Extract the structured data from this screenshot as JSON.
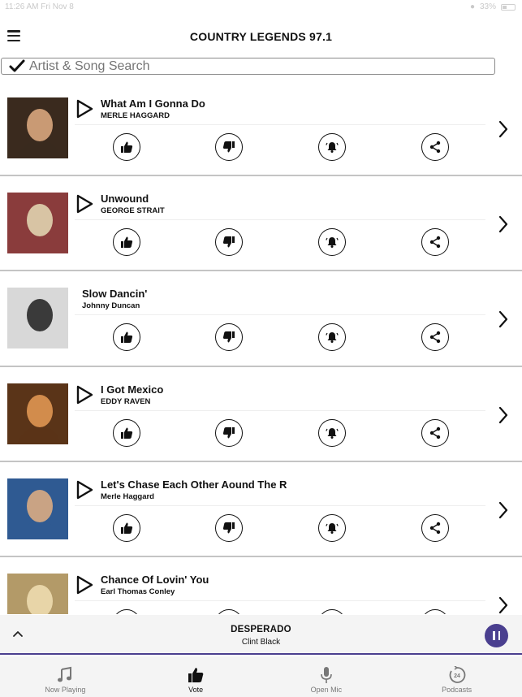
{
  "status_bar": {
    "time": "11:26 AM  Fri Nov 8",
    "battery": "33%"
  },
  "header": {
    "title": "COUNTRY LEGENDS 97.1"
  },
  "search": {
    "placeholder": "Artist & Song Search"
  },
  "songs": [
    {
      "title": "What Am I Gonna Do",
      "artist": "MERLE HAGGARD",
      "has_play": true,
      "art_colors": [
        "#3a2a1e",
        "#c99a74"
      ]
    },
    {
      "title": "Unwound",
      "artist": "GEORGE STRAIT",
      "has_play": true,
      "art_colors": [
        "#8a3c3c",
        "#d8c4a4"
      ]
    },
    {
      "title": "Slow Dancin'",
      "artist": "Johnny Duncan",
      "has_play": false,
      "art_colors": [
        "#d8d8d8",
        "#3a3a3a"
      ]
    },
    {
      "title": "I Got Mexico",
      "artist": "EDDY RAVEN",
      "has_play": true,
      "art_colors": [
        "#5a3418",
        "#d28c4c"
      ]
    },
    {
      "title": "Let's Chase Each Other Aound The R",
      "artist": "Merle Haggard",
      "has_play": true,
      "art_colors": [
        "#2f5a92",
        "#c9a384"
      ]
    },
    {
      "title": "Chance Of Lovin' You",
      "artist": "Earl Thomas Conley",
      "has_play": true,
      "art_colors": [
        "#b39a68",
        "#e8d5a8"
      ]
    }
  ],
  "now_playing": {
    "title": "DESPERADO",
    "artist": "Clint Black",
    "accent_color": "#4a3f8f"
  },
  "tabs": [
    {
      "label": "Now Playing",
      "icon": "music-note-icon",
      "active": false
    },
    {
      "label": "Vote",
      "icon": "thumbs-up-icon",
      "active": true
    },
    {
      "label": "Open Mic",
      "icon": "microphone-icon",
      "active": false
    },
    {
      "label": "Podcasts",
      "icon": "podcast-24-icon",
      "active": false
    }
  ]
}
